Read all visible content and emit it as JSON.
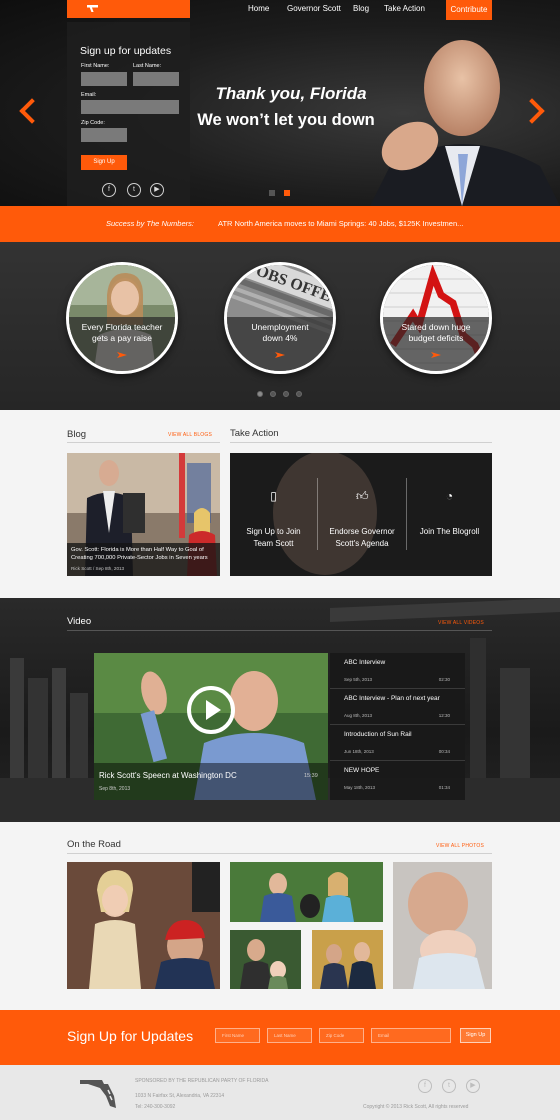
{
  "nav": {
    "items": [
      "Home",
      "Governor Scott",
      "Blog",
      "Take Action"
    ],
    "contribute": "Contribute"
  },
  "hero": {
    "signup": {
      "title": "Sign up for updates",
      "first_name_label": "First Name:",
      "last_name_label": "Last Name:",
      "email_label": "Email:",
      "zip_label": "Zip Code:",
      "button": "Sign Up"
    },
    "social_icons": [
      "facebook-icon",
      "twitter-icon",
      "youtube-icon"
    ],
    "headline": "Thank you, Florida",
    "subheadline": "We won’t let you down",
    "slide_count": 2,
    "active_slide": 2
  },
  "ticker": {
    "label": "Success by The Numbers:",
    "text": "ATR North America moves to Miami Springs: 40 Jobs, $125K Investmen..."
  },
  "accomplishments": {
    "items": [
      {
        "line1": "Every Florida teacher",
        "line2": "gets a pay raise"
      },
      {
        "line1": "Unemployment",
        "line2": "down 4%"
      },
      {
        "line1": "Stared down huge",
        "line2": "budget deficits"
      }
    ],
    "dots": 4,
    "active_dot": 1
  },
  "blog": {
    "title": "Blog",
    "view_all": "VIEW ALL BLOGS",
    "headline_line1": "Gov. Scott: Florida is More than Half Way to Goal of",
    "headline_line2": "Creating 700,000 Private-Sector Jobs in Seven years",
    "meta": "Rick Scott / Sep 8th, 2013"
  },
  "take_action": {
    "title": "Take Action",
    "items": [
      {
        "icon": "document-add-icon",
        "line1": "Sign Up to Join",
        "line2": "Team Scott"
      },
      {
        "icon": "thumbs-up-icon",
        "line1": "Endorse Governor",
        "line2": "Scott's Agenda"
      },
      {
        "icon": "rss-icon",
        "line1": "Join The Blogroll",
        "line2": ""
      }
    ]
  },
  "video": {
    "title": "Video",
    "view_all": "VIEW ALL VIDEOS",
    "featured": {
      "title": "Rick Scott's Speecn at Washington DC",
      "date": "Sep 8th, 2013",
      "length": "15:39"
    },
    "playlist": [
      {
        "title": "ABC Interview",
        "date": "Sep 5th, 2013",
        "length": "02:30"
      },
      {
        "title": "ABC Interview - Plan of next year",
        "date": "Aug 8th, 2013",
        "length": "12:30"
      },
      {
        "title": "Introduction of Sun Rail",
        "date": "Jun 18th, 2013",
        "length": "00:34"
      },
      {
        "title": "NEW HOPE",
        "date": "May 18th, 2013",
        "length": "01:34"
      }
    ]
  },
  "road": {
    "title": "On the Road",
    "view_all": "VIEW ALL PHOTOS"
  },
  "footer_signup": {
    "title": "Sign Up for Updates",
    "placeholders": [
      "First Name",
      "Last Name",
      "Zip Code",
      "Email"
    ],
    "button": "Sign Up"
  },
  "footer": {
    "sponsor": "SPONSORED BY THE REPUBLICAN PARTY OF FLORIDA",
    "address": "1033 N Fairfax St, Alexandria, VA 22314",
    "phone": "Tel: 240-300-3092",
    "copyright": "Copyright © 2013 Rick Scott, All rights reserved"
  },
  "colors": {
    "accent": "#ff5a0a",
    "dark": "#1c1c1c"
  }
}
